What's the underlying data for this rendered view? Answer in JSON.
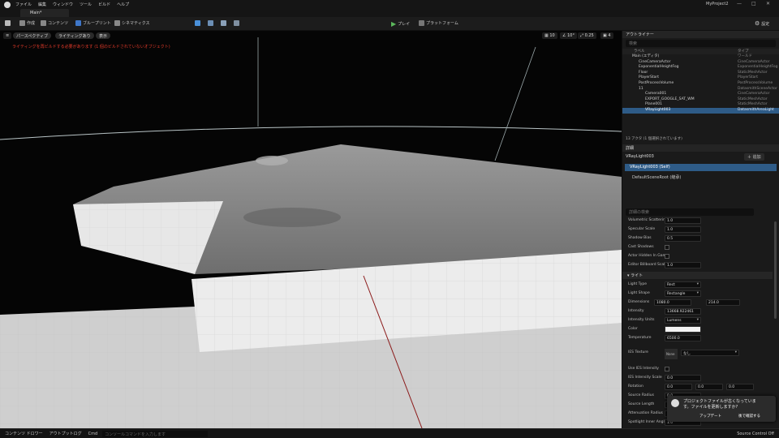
{
  "menubar": {
    "items": [
      "ファイル",
      "編集",
      "ウィンドウ",
      "ツール",
      "ビルド",
      "ヘルプ"
    ],
    "project_name": "MyProject2"
  },
  "tabs": {
    "level_tab": "Main*"
  },
  "toolbar": {
    "save_icon": "save-icon",
    "create": "作成",
    "content": "コンテンツ",
    "blueprint": "ブループリント",
    "cinematics": "シネマティクス",
    "play": "プレイ",
    "platform": "プラットフォーム",
    "settings": "設定"
  },
  "viewport": {
    "perspective": "パースペクティブ",
    "lighting": "ライティングあり",
    "show": "表示",
    "grid_size": "10",
    "angle": "10°",
    "scale": "0.25",
    "camera_speed": "4",
    "warning": "ライティングを再ビルドする必要があります (1 個のビルドされていないオブジェクト)"
  },
  "outliner": {
    "title": "アウトライナー",
    "search_placeholder": "検索",
    "col_label": "ラベル",
    "col_type": "タイプ",
    "rows": [
      {
        "label": "Main (エディタ)",
        "type": "ワールド"
      },
      {
        "label": "CineCameraActor",
        "type": "CineCameraActor"
      },
      {
        "label": "ExponentialHeightFog",
        "type": "ExponentialHeightFog"
      },
      {
        "label": "Floor",
        "type": "StaticMeshActor"
      },
      {
        "label": "PlayerStart",
        "type": "PlayerStart"
      },
      {
        "label": "PostProcessVolume",
        "type": "PostProcessVolume"
      },
      {
        "label": "11",
        "type": "DatasmithSceneActor"
      },
      {
        "label": "Camera001",
        "type": "CineCameraActor"
      },
      {
        "label": "EXPORT_GOOGLE_SAT_WM",
        "type": "StaticMeshActor"
      },
      {
        "label": "Plane001",
        "type": "StaticMeshActor"
      },
      {
        "label": "VRayLight003",
        "type": "DatasmithAreaLight"
      }
    ],
    "footer": "13 アクタ (1 個選択されています)"
  },
  "details": {
    "tab": "詳細",
    "actor_name": "VRayLight003",
    "add_button": "追加",
    "self_row": "VRayLight003 (Self)",
    "component": "DefaultSceneRoot (継承)",
    "search_placeholder": "詳細の検索",
    "properties": [
      {
        "label": "Volumetric Scattering...",
        "value": "1.0"
      },
      {
        "label": "Specular Scale",
        "value": "1.0"
      },
      {
        "label": "Shadow Bias",
        "value": "0.5"
      },
      {
        "label": "Cast Shadows",
        "value": ""
      },
      {
        "label": "Actor Hidden In Game",
        "value": ""
      },
      {
        "label": "Editor Billboard Scale",
        "value": "1.0"
      }
    ],
    "light_section": "ライト",
    "light_type": {
      "label": "Light Type",
      "value": "Rect"
    },
    "light_shape": {
      "label": "Light Shape",
      "value": "Rectangle"
    },
    "dimensions": {
      "label": "Dimensions",
      "value1": "1080.0",
      "value2": "214.0"
    },
    "intensity": {
      "label": "Intensity",
      "value": "13668.922461"
    },
    "intensity_units": {
      "label": "Intensity Units",
      "value": "Lumens"
    },
    "color": {
      "label": "Color",
      "value": "#f4f4f4"
    },
    "temperature": {
      "label": "Temperature",
      "value": "6500.0"
    },
    "ies_texture": {
      "label": "IES Texture",
      "thumb": "None",
      "value": "なし"
    },
    "use_ies": {
      "label": "Use IES Intensity"
    },
    "ies_scale": {
      "label": "IES Intensity Scale",
      "value": "0.0"
    },
    "rotation": {
      "label": "Rotation",
      "x": "0.0",
      "y": "0.0",
      "z": "0.0"
    },
    "source_radius": {
      "label": "Source Radius",
      "value": "0.0"
    },
    "source_length": {
      "label": "Source Length",
      "value": ""
    },
    "attenuation": {
      "label": "Attenuation Radius",
      "value": ""
    },
    "spotlight_inner": {
      "label": "Spotlight Inner Angle",
      "value": "1.0"
    }
  },
  "toast": {
    "message_line1": "プロジェクトファイルが古くなっていま",
    "message_line2": "す。ファイルを更新しますか?",
    "update_button": "アップデート",
    "dismiss_button": "後で確認する"
  },
  "statusbar": {
    "content_drawer": "コンテンツ ドロワー",
    "output_log": "アウトプットログ",
    "cmd": "Cmd",
    "console_placeholder": "コンソールコマンドを入力します",
    "source_control": "Source Control Off"
  },
  "colors": {
    "accent_blue": "#4a90d9",
    "play_green": "#5cb85c",
    "warning_red": "#e23a2a",
    "selected_row": "#2e5b87"
  }
}
